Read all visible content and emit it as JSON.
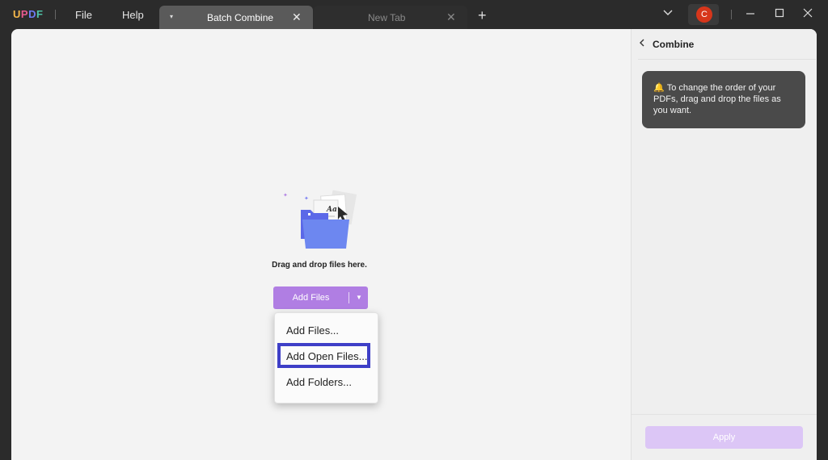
{
  "app": {
    "logo_letters": [
      "U",
      "P",
      "D",
      "F"
    ],
    "menu": {
      "file": "File",
      "help": "Help"
    }
  },
  "tabs": [
    {
      "title": "Batch Combine",
      "active": true
    },
    {
      "title": "New Tab",
      "active": false
    }
  ],
  "window_controls": {
    "close_tab": "✕",
    "new_tab": "+",
    "dropdown": "⌄",
    "minimize": "—",
    "maximize": "☐",
    "close": "✕"
  },
  "user": {
    "avatar_initial": "C",
    "avatar_color": "#d7361b"
  },
  "main": {
    "drag_text": "Drag and drop files here.",
    "add_button_label": "Add Files",
    "dropdown_items": [
      "Add Files...",
      "Add Open Files...",
      "Add Folders..."
    ]
  },
  "right_panel": {
    "title": "Combine",
    "tip_text": "To change the order of your PDFs, drag and drop the files as you want.",
    "apply_label": "Apply"
  },
  "colors": {
    "accent_purple": "#b07ee3",
    "apply_disabled": "#dcc6f6",
    "highlight_border": "#3e3fc7"
  }
}
